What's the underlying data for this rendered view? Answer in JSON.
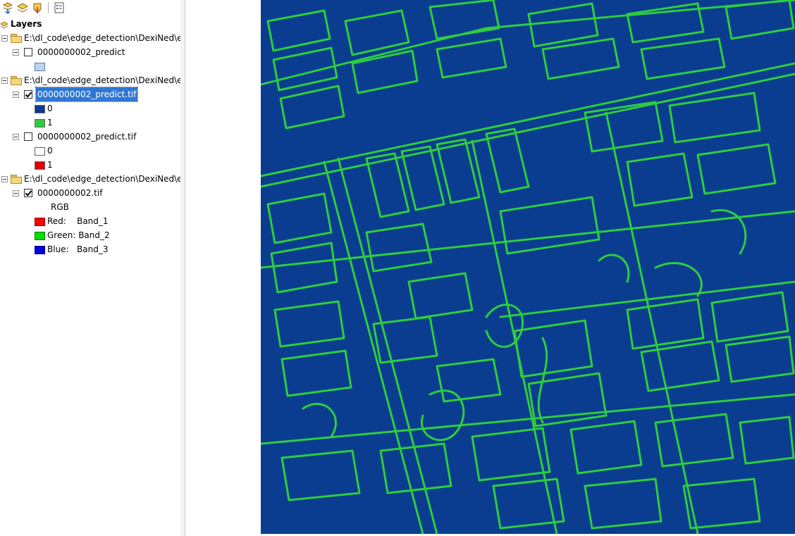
{
  "toolbar": {
    "buttons": [
      "list-by-drawing-order-icon",
      "list-by-source-icon",
      "list-by-visibility-icon",
      "options-icon"
    ]
  },
  "toc": {
    "root_label": "Layers",
    "groups": [
      {
        "path": "E:\\dl_code\\edge_detection\\DexiNed\\e",
        "layers": [
          {
            "name": "0000000002_predict",
            "checked": false,
            "legend": [
              {
                "label": "",
                "color": "#bcd2ee"
              }
            ]
          }
        ]
      },
      {
        "path": "E:\\dl_code\\edge_detection\\DexiNed\\e",
        "layers": [
          {
            "name": "0000000002_predict.tif",
            "checked": true,
            "selected": true,
            "legend": [
              {
                "label": "0",
                "color": "#0a3d8f"
              },
              {
                "label": "1",
                "color": "#2ecc40"
              }
            ]
          },
          {
            "name": "0000000002_predict.tif",
            "checked": false,
            "legend": [
              {
                "label": "0",
                "color": "#ffffff"
              },
              {
                "label": "1",
                "color": "#e00000"
              }
            ]
          }
        ]
      },
      {
        "path": "E:\\dl_code\\edge_detection\\DexiNed\\e",
        "layers": [
          {
            "name": "0000000002.tif",
            "checked": true,
            "legend_header": "RGB",
            "legend": [
              {
                "label": "Red:    Band_1",
                "color": "#ff0000"
              },
              {
                "label": "Green: Band_2",
                "color": "#00e000"
              },
              {
                "label": "Blue:   Band_3",
                "color": "#0000e0"
              }
            ]
          }
        ]
      }
    ]
  },
  "map": {
    "background_color": "#0a3d8f",
    "edge_color": "#2ecc40",
    "description_colors": {
      "canvas": "#ffffff"
    }
  }
}
